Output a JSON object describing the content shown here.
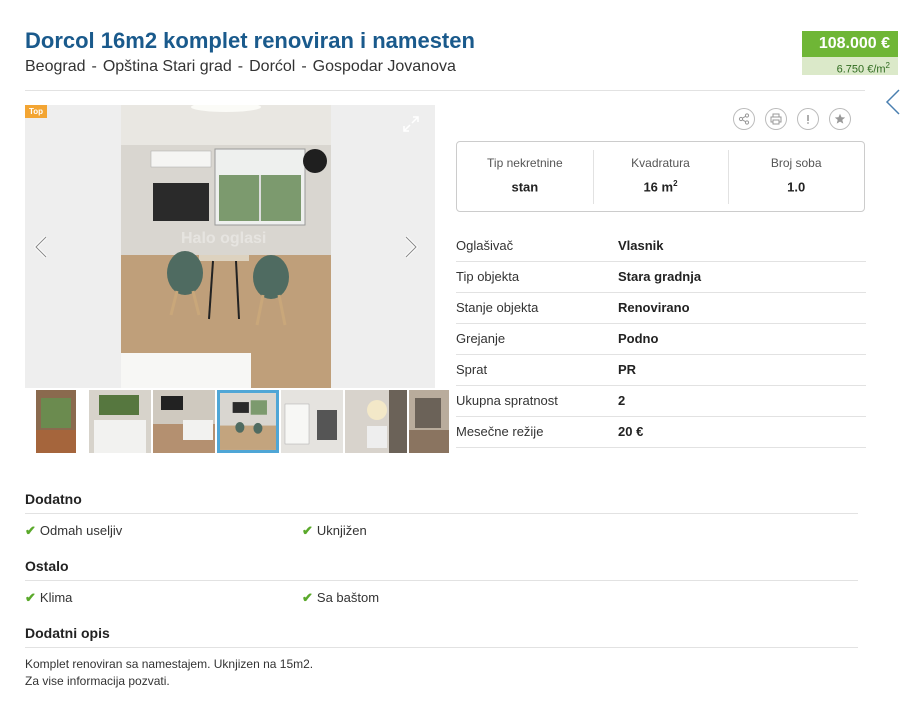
{
  "listing": {
    "title": "Dorcol 16m2 komplet renoviran i namesten",
    "breadcrumb": [
      "Beograd",
      "Opština Stari grad",
      "Dorćol",
      "Gospodar Jovanova"
    ],
    "breadcrumb_sep": "-",
    "price": "108.000 €",
    "price_per_sqm": "6.750 €/m",
    "price_per_sqm_sup": "2"
  },
  "gallery": {
    "badge": "Top",
    "watermark": "Halo oglasi"
  },
  "summary": [
    {
      "label": "Tip nekretnine",
      "value": "stan",
      "sup": ""
    },
    {
      "label": "Kvadratura",
      "value": "16 m",
      "sup": "2"
    },
    {
      "label": "Broj soba",
      "value": "1.0",
      "sup": ""
    }
  ],
  "details": [
    {
      "key": "Oglašivač",
      "value": "Vlasnik"
    },
    {
      "key": "Tip objekta",
      "value": "Stara gradnja"
    },
    {
      "key": "Stanje objekta",
      "value": "Renovirano"
    },
    {
      "key": "Grejanje",
      "value": "Podno"
    },
    {
      "key": "Sprat",
      "value": "PR"
    },
    {
      "key": "Ukupna spratnost",
      "value": "2"
    },
    {
      "key": "Mesečne režije",
      "value": "20 €"
    }
  ],
  "sections": {
    "dodatno": {
      "title": "Dodatno",
      "items": [
        "Odmah useljiv",
        "Uknjižen"
      ]
    },
    "ostalo": {
      "title": "Ostalo",
      "items": [
        "Klima",
        "Sa baštom"
      ]
    },
    "opis": {
      "title": "Dodatni opis",
      "lines": [
        "Komplet renoviran sa namestajem. Uknjizen na 15m2.",
        "Za vise informacija pozvati."
      ]
    }
  },
  "icons": {
    "share": "share-icon",
    "print": "print-icon",
    "report": "exclamation-icon",
    "favorite": "star-icon",
    "check": "check-icon",
    "prev": "chevron-left-icon",
    "next": "chevron-right-icon",
    "expand": "expand-icon"
  },
  "colors": {
    "title": "#1a5a8c",
    "price_bg": "#6fb636",
    "check": "#5aa92b",
    "badge": "#f3a533",
    "thumb_selected": "#4fa6d6"
  }
}
